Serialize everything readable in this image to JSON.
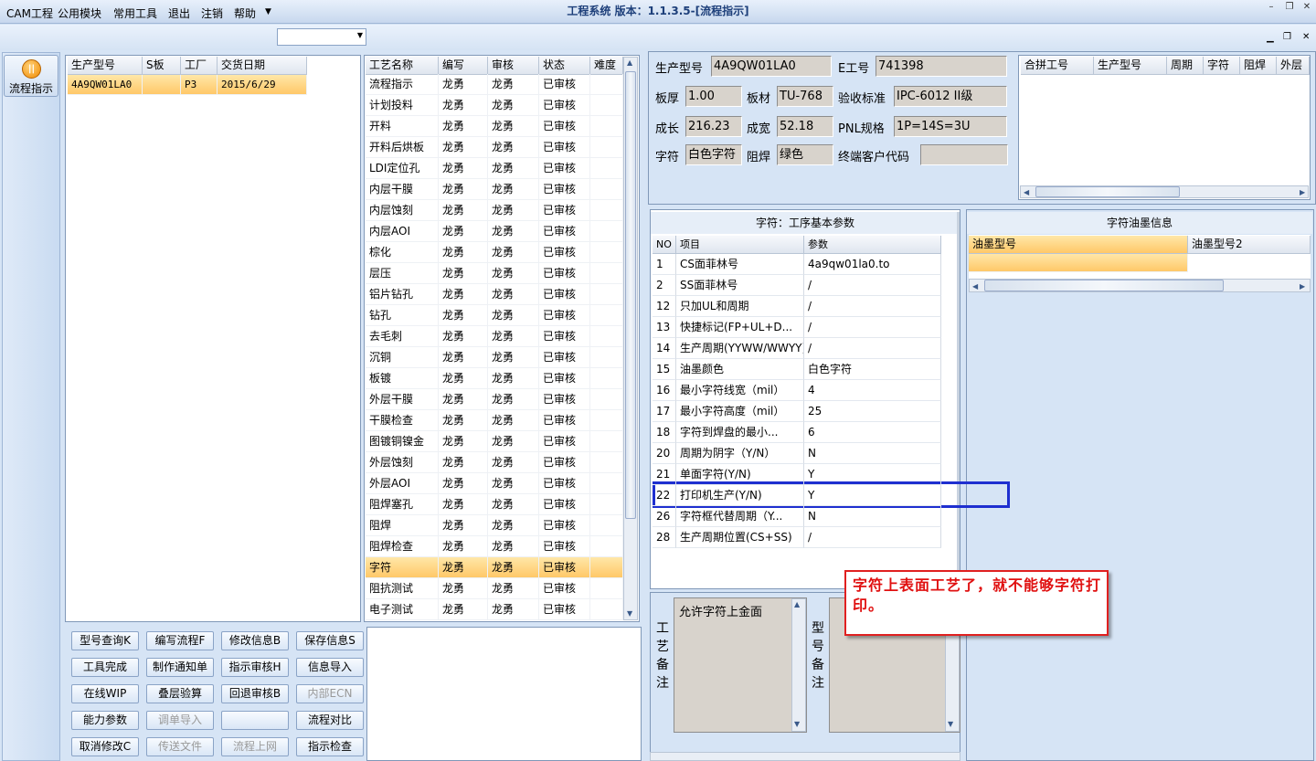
{
  "window": {
    "title": "工程系统 版本：1.1.3.5-[流程指示]"
  },
  "menu": [
    "CAM工程",
    "公用模块",
    "常用工具",
    "退出",
    "注销",
    "帮助"
  ],
  "nav": {
    "label": "流程指示"
  },
  "jobs_table": {
    "headers": [
      "生产型号",
      "S板",
      "工厂",
      "交货日期"
    ],
    "rows": [
      [
        "4A9QW01LA0",
        "",
        "P3",
        "2015/6/29"
      ]
    ]
  },
  "process_table": {
    "headers": [
      "工艺名称",
      "编写",
      "审核",
      "状态",
      "难度"
    ],
    "rows": [
      [
        "流程指示",
        "龙勇",
        "龙勇",
        "已审核",
        ""
      ],
      [
        "计划投料",
        "龙勇",
        "龙勇",
        "已审核",
        ""
      ],
      [
        "开料",
        "龙勇",
        "龙勇",
        "已审核",
        ""
      ],
      [
        "开料后烘板",
        "龙勇",
        "龙勇",
        "已审核",
        ""
      ],
      [
        "LDI定位孔",
        "龙勇",
        "龙勇",
        "已审核",
        ""
      ],
      [
        "内层干膜",
        "龙勇",
        "龙勇",
        "已审核",
        ""
      ],
      [
        "内层蚀刻",
        "龙勇",
        "龙勇",
        "已审核",
        ""
      ],
      [
        "内层AOI",
        "龙勇",
        "龙勇",
        "已审核",
        ""
      ],
      [
        "棕化",
        "龙勇",
        "龙勇",
        "已审核",
        ""
      ],
      [
        "层压",
        "龙勇",
        "龙勇",
        "已审核",
        ""
      ],
      [
        "铝片钻孔",
        "龙勇",
        "龙勇",
        "已审核",
        ""
      ],
      [
        "钻孔",
        "龙勇",
        "龙勇",
        "已审核",
        ""
      ],
      [
        "去毛刺",
        "龙勇",
        "龙勇",
        "已审核",
        ""
      ],
      [
        "沉铜",
        "龙勇",
        "龙勇",
        "已审核",
        ""
      ],
      [
        "板镀",
        "龙勇",
        "龙勇",
        "已审核",
        ""
      ],
      [
        "外层干膜",
        "龙勇",
        "龙勇",
        "已审核",
        ""
      ],
      [
        "干膜检查",
        "龙勇",
        "龙勇",
        "已审核",
        ""
      ],
      [
        "图镀铜镍金",
        "龙勇",
        "龙勇",
        "已审核",
        ""
      ],
      [
        "外层蚀刻",
        "龙勇",
        "龙勇",
        "已审核",
        ""
      ],
      [
        "外层AOI",
        "龙勇",
        "龙勇",
        "已审核",
        ""
      ],
      [
        "阻焊塞孔",
        "龙勇",
        "龙勇",
        "已审核",
        ""
      ],
      [
        "阻焊",
        "龙勇",
        "龙勇",
        "已审核",
        ""
      ],
      [
        "阻焊检查",
        "龙勇",
        "龙勇",
        "已审核",
        ""
      ],
      [
        "字符",
        "龙勇",
        "龙勇",
        "已审核",
        ""
      ],
      [
        "阻抗测试",
        "龙勇",
        "龙勇",
        "已审核",
        ""
      ],
      [
        "电子测试",
        "龙勇",
        "龙勇",
        "已审核",
        ""
      ]
    ],
    "selected_index": 23
  },
  "buttons": [
    [
      "型号查询K",
      "编写流程F",
      "修改信息B",
      "保存信息S"
    ],
    [
      "工具完成",
      "制作通知单",
      "指示审核H",
      "信息导入"
    ],
    [
      "在线WIP",
      "叠层验算",
      "回退审核B",
      "内部ECN"
    ],
    [
      "能力参数",
      "调单导入",
      "",
      "流程对比"
    ],
    [
      "取消修改C",
      "传送文件",
      "流程上网",
      "指示检查"
    ]
  ],
  "disabled_buttons": [
    "内部ECN",
    "调单导入",
    "",
    "传送文件",
    "流程上网"
  ],
  "info": {
    "model_label": "生产型号",
    "model": "4A9QW01LA0",
    "e_label": "E工号",
    "e": "741398",
    "thickness_label": "板厚",
    "thickness": "1.00",
    "material_label": "板材",
    "material": "TU-768",
    "standard_label": "验收标准",
    "standard": "IPC-6012 II级",
    "length_label": "成长",
    "length": "216.23",
    "width_label": "成宽",
    "width": "52.18",
    "pnl_label": "PNL规格",
    "pnl": "1P=14S=3U",
    "silk_label": "字符",
    "silk": "白色字符",
    "mask_label": "阻焊",
    "mask": "绿色",
    "customer_label": "终端客户代码",
    "customer": ""
  },
  "merge_table": {
    "headers": [
      "合拼工号",
      "生产型号",
      "周期",
      "字符",
      "阻焊",
      "外层"
    ]
  },
  "params": {
    "title": "字符：工序基本参数",
    "headers": [
      "NO",
      "项目",
      "参数"
    ],
    "rows": [
      [
        "1",
        "CS面菲林号",
        "4a9qw01la0.to"
      ],
      [
        "2",
        "SS面菲林号",
        "/"
      ],
      [
        "12",
        "只加UL和周期",
        "/"
      ],
      [
        "13",
        "快捷标记(FP+UL+D...",
        "/"
      ],
      [
        "14",
        "生产周期(YYWW/WWYY)",
        "/"
      ],
      [
        "15",
        "油墨颜色",
        "白色字符"
      ],
      [
        "16",
        "最小字符线宽（mil）",
        "4"
      ],
      [
        "17",
        "最小字符高度（mil）",
        "25"
      ],
      [
        "18",
        "字符到焊盘的最小...",
        "6"
      ],
      [
        "20",
        "周期为阴字（Y/N）",
        "N"
      ],
      [
        "21",
        "单面字符(Y/N)",
        "Y"
      ],
      [
        "22",
        "打印机生产(Y/N)",
        "Y"
      ],
      [
        "26",
        "字符框代替周期（Y...",
        "N"
      ],
      [
        "28",
        "生产周期位置(CS+SS)",
        "/"
      ]
    ]
  },
  "ink": {
    "title": "字符油墨信息",
    "headers": [
      "油墨型号",
      "油墨型号2"
    ]
  },
  "process_note": {
    "label": "工艺备注",
    "text": "允许字符上金面"
  },
  "model_note": {
    "label": "型号备注"
  },
  "annotation": "字符上表面工艺了，就不能够字符打印。",
  "colors": {
    "accent": "#ffc868",
    "highlight_box": "#1e2fd0",
    "note_border": "#e02020",
    "note_text": "#e01010"
  }
}
